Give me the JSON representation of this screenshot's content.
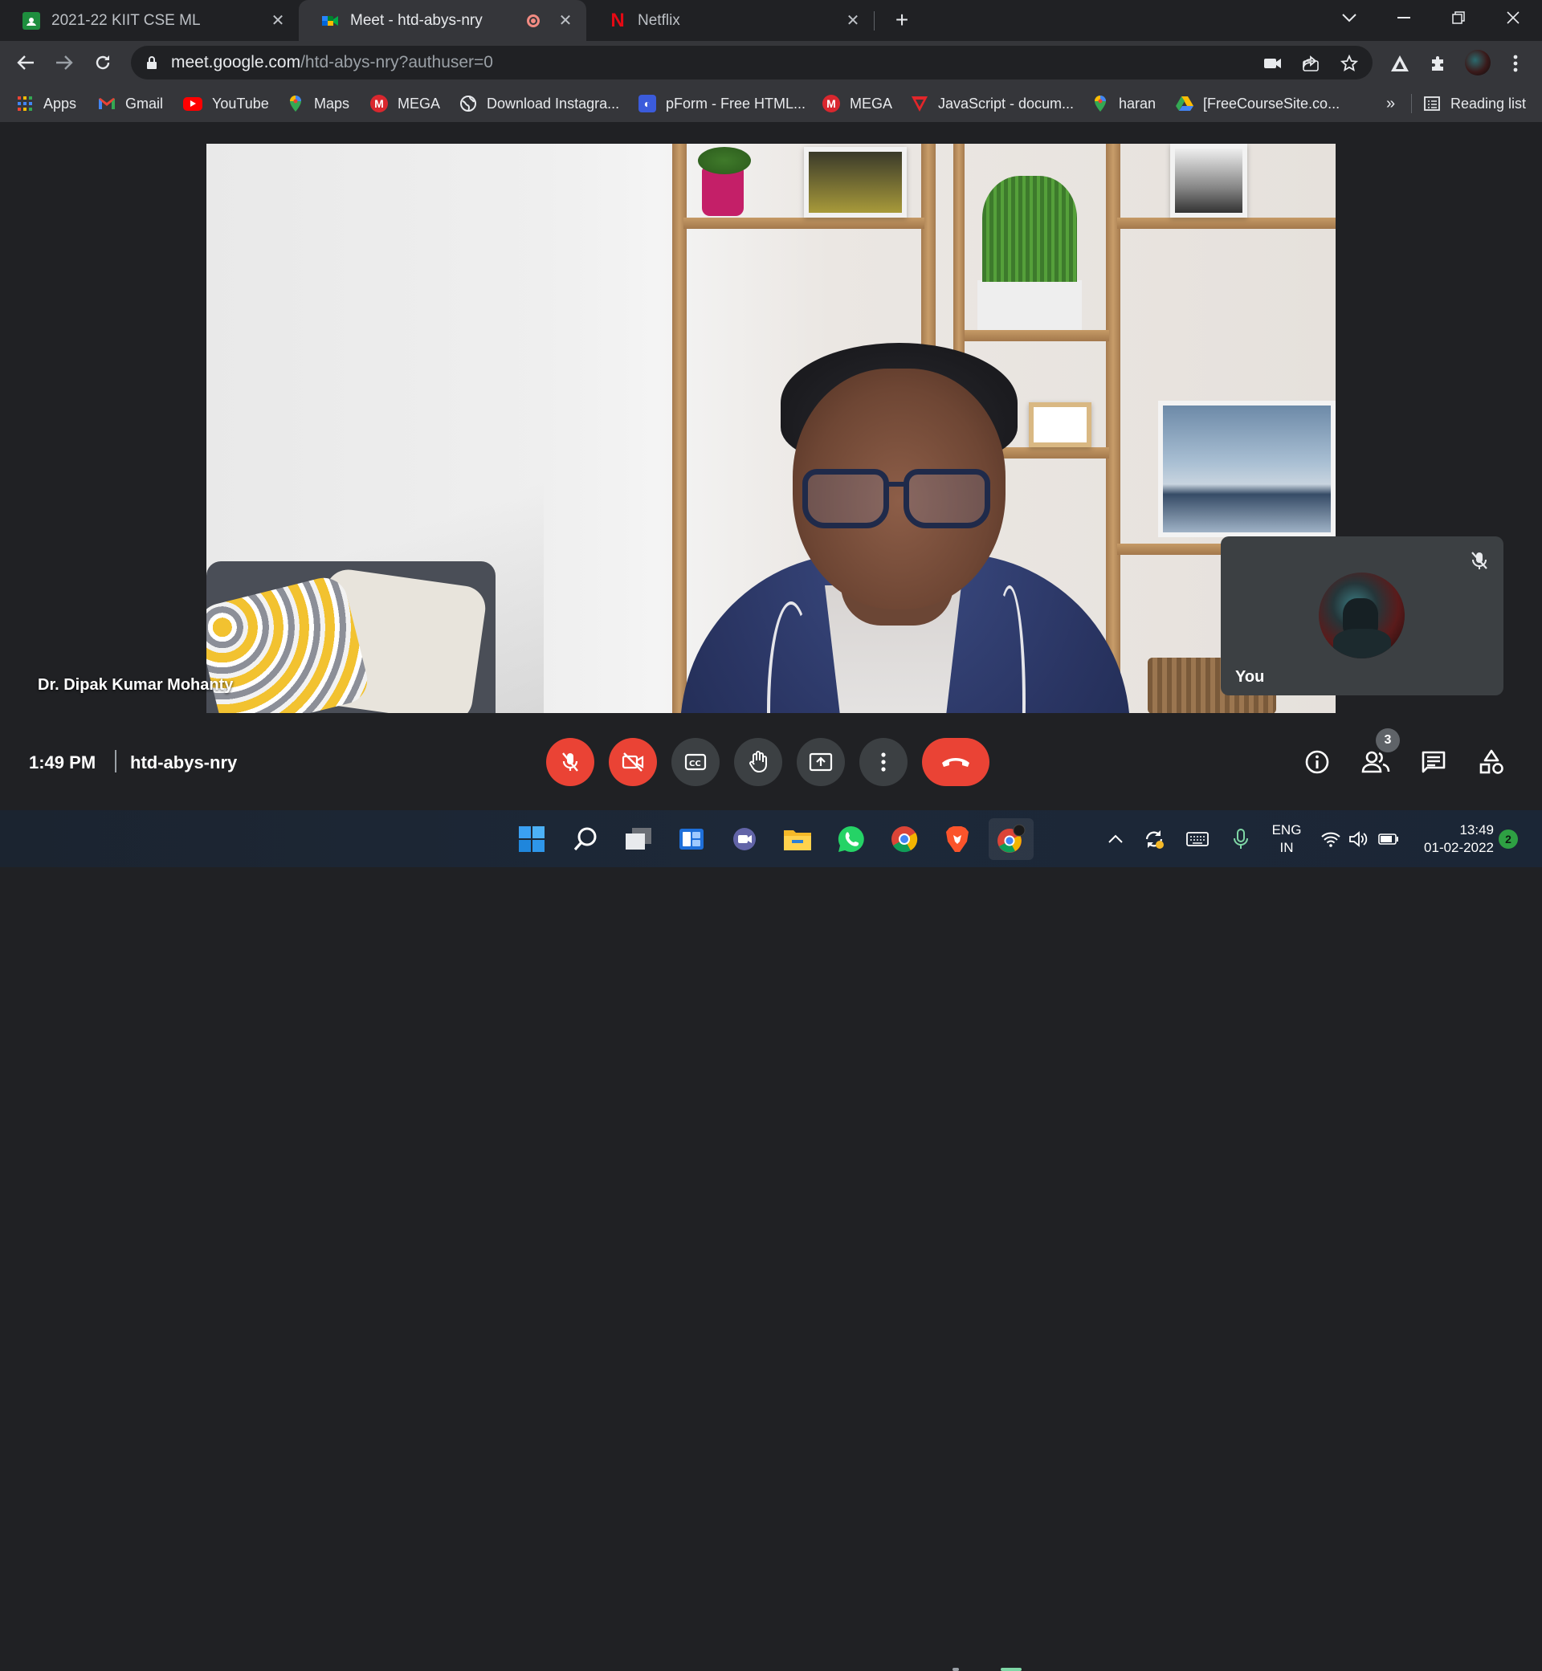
{
  "browser": {
    "tabs": [
      {
        "title": "2021-22 KIIT CSE ML",
        "favicon": "google-classroom-icon",
        "active": false
      },
      {
        "title": "Meet - htd-abys-nry",
        "favicon": "google-meet-icon",
        "active": true,
        "recording": true
      },
      {
        "title": "Netflix",
        "favicon": "netflix-icon",
        "active": false
      }
    ],
    "url": {
      "host": "meet.google.com",
      "path": "/htd-abys-nry?authuser=0"
    },
    "bookmarks": [
      {
        "label": "Apps",
        "icon": "apps-grid-icon"
      },
      {
        "label": "Gmail",
        "icon": "gmail-icon"
      },
      {
        "label": "YouTube",
        "icon": "youtube-icon"
      },
      {
        "label": "Maps",
        "icon": "maps-pin-icon"
      },
      {
        "label": "MEGA",
        "icon": "mega-icon"
      },
      {
        "label": "Download Instagra...",
        "icon": "globe-icon"
      },
      {
        "label": "pForm - Free HTML...",
        "icon": "pform-icon"
      },
      {
        "label": "MEGA",
        "icon": "mega-icon"
      },
      {
        "label": "JavaScript - docum...",
        "icon": "javascript-icon"
      },
      {
        "label": "haran",
        "icon": "maps-pin-icon"
      },
      {
        "label": "[FreeCourseSite.co...",
        "icon": "google-drive-icon"
      }
    ],
    "bookmarks_overflow": "»",
    "reading_list": "Reading list"
  },
  "meet": {
    "speaker_name": "Dr. Dipak Kumar Mohanty",
    "self_label": "You",
    "time": "1:49 PM",
    "meeting_code": "htd-abys-nry",
    "participants_count": "3",
    "controls": [
      "microphone-off",
      "camera-off",
      "captions",
      "raise-hand",
      "present-screen",
      "more-options",
      "leave-call"
    ],
    "right_controls": [
      "meeting-details",
      "people",
      "chat",
      "activities"
    ]
  },
  "taskbar": {
    "apps": [
      "start",
      "search",
      "task-view",
      "widgets",
      "chat",
      "file-explorer",
      "whatsapp",
      "chrome",
      "brave",
      "chrome-profile"
    ],
    "language_line1": "ENG",
    "language_line2": "IN",
    "clock_time": "13:49",
    "clock_date": "01-02-2022",
    "notification_count": "2"
  },
  "colors": {
    "meet_red": "#ea4335",
    "control_gray": "#3c4043",
    "background": "#202124"
  }
}
